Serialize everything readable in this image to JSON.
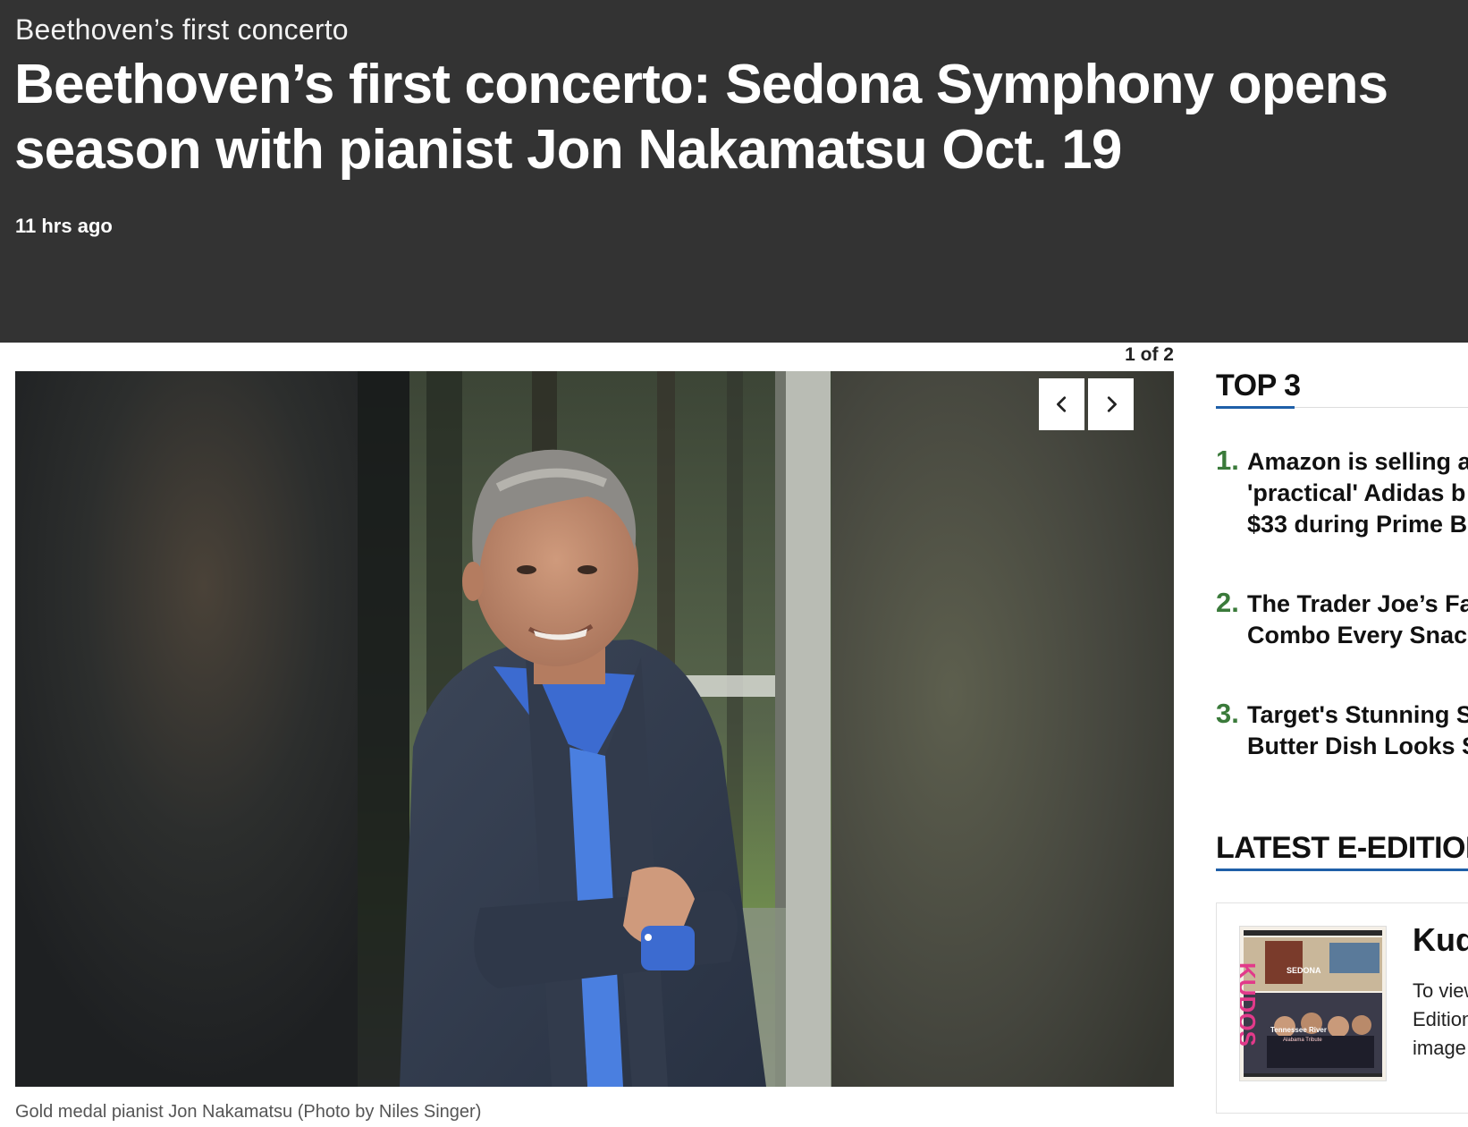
{
  "article": {
    "kicker": "Beethoven’s first concerto",
    "headline_line1": "Beethoven’s first concerto: Sedona Symphony opens",
    "headline_line2": "season with pianist Jon Nakamatsu Oct. 19",
    "timestamp": "11 hrs ago"
  },
  "gallery": {
    "counter": "1 of 2",
    "caption": "Gold medal pianist Jon Nakamatsu (Photo by Niles Singer)",
    "prev_icon": "chevron-left-icon",
    "next_icon": "chevron-right-icon"
  },
  "sidebar": {
    "top_heading": "TOP 3",
    "top_items": [
      {
        "number": "1.",
        "title": "Amazon is selling a\n'practical' Adidas b\n$33 during Prime B"
      },
      {
        "number": "2.",
        "title": "The Trader Joe’s Fal\nCombo Every Snack"
      },
      {
        "number": "3.",
        "title": "Target's Stunning S\nButter Dish Looks S"
      }
    ],
    "eedition_heading": "LATEST E-EDITION",
    "eedition": {
      "title": "Kud",
      "description": "To view\nEdition\nimage",
      "cover_masthead": "SEDONA",
      "cover_letters": "KUDOS",
      "cover_headline": "Tennessee River",
      "cover_subhead": "Alabama Tribute"
    }
  },
  "colors": {
    "header_bg": "#333333",
    "rank_number": "#3a7a3a",
    "heading_underline": "#1f5fa8"
  }
}
